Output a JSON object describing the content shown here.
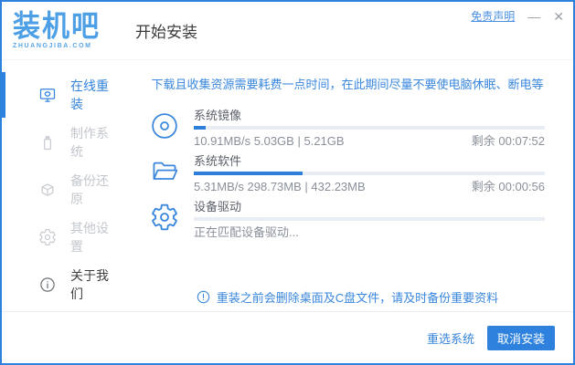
{
  "header": {
    "logo_title": "装机吧",
    "logo_subtitle": "ZHUANGJIBA.COM",
    "page_title": "开始安装",
    "disclaimer_link": "免责声明",
    "minimize_label": "—",
    "close_label": "✕"
  },
  "sidebar": {
    "items": [
      {
        "label": "在线重装",
        "icon": "monitor-reinstall-icon",
        "active": true
      },
      {
        "label": "制作系统",
        "icon": "usb-icon",
        "active": false
      },
      {
        "label": "备份还原",
        "icon": "backup-restore-icon",
        "active": false
      },
      {
        "label": "其他设置",
        "icon": "settings-icon",
        "active": false
      },
      {
        "label": "关于我们",
        "icon": "info-icon",
        "active": false
      }
    ]
  },
  "main": {
    "tip": "下载且收集资源需要耗费一点时间，在此期间尽量不要使电脑休眠、断电等",
    "tasks": [
      {
        "name": "系统镜像",
        "icon": "disc-icon",
        "stats": "10.91MB/s 5.03GB | 5.21GB",
        "remaining": "剩余 00:07:52",
        "progress_percent": 3.5
      },
      {
        "name": "系统软件",
        "icon": "folder-icon",
        "stats": "5.31MB/s 298.73MB | 432.23MB",
        "remaining": "剩余 00:00:56",
        "progress_percent": 31
      },
      {
        "name": "设备驱动",
        "icon": "gear-icon",
        "stats": "正在匹配设备驱动...",
        "remaining": "",
        "progress_percent": 0
      }
    ],
    "notice": "重装之前会删除桌面及C盘文件，请及时备份重要资料"
  },
  "footer": {
    "reselect_label": "重选系统",
    "cancel_label": "取消安装"
  },
  "colors": {
    "accent": "#2e82de",
    "icon_blue": "#3b87dc",
    "tip_text": "#3a87dd",
    "progress_fill": "#2e7fd9",
    "progress_track": "#e8edf4",
    "inactive_text": "#c3c7cd"
  }
}
